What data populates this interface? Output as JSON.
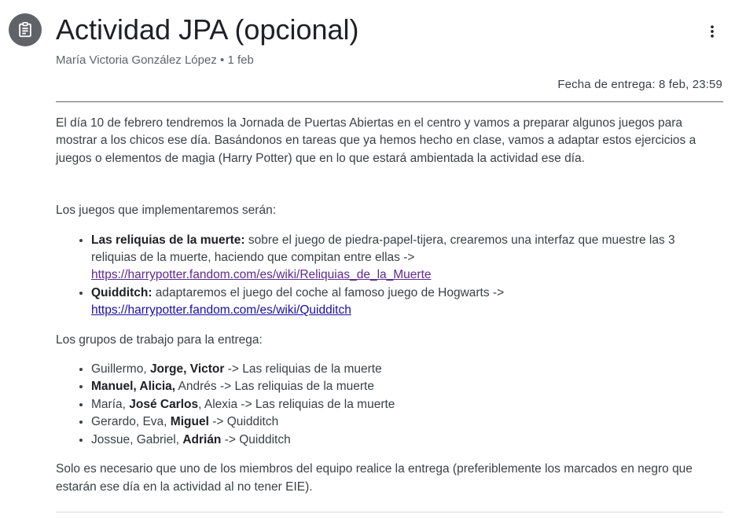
{
  "header": {
    "title": "Actividad JPA (opcional)",
    "author": "María Victoria González López",
    "date": "1 feb",
    "due": "Fecha de entrega: 8 feb, 23:59"
  },
  "body": {
    "intro": "El día 10 de febrero tendremos la Jornada de Puertas Abiertas en el centro y vamos a preparar algunos juegos para mostrar a los chicos ese día. Basándonos en tareas que ya hemos hecho en clase, vamos a adaptar estos ejercicios a juegos o elementos de magia (Harry Potter) que en lo que estará ambientada la actividad ese día.",
    "games_heading": "Los juegos que implementaremos serán:",
    "games": [
      {
        "name": "Las reliquias de la muerte:",
        "text": " sobre el juego de piedra-papel-tijera, crearemos una interfaz que muestre las 3 reliquias de la muerte, haciendo que compitan entre ellas -> ",
        "link": "https://harrypotter.fandom.com/es/wiki/Reliquias_de_la_Muerte"
      },
      {
        "name": "Quidditch:",
        "text": " adaptaremos el juego del coche al famoso juego de Hogwarts -> ",
        "link": "https://harrypotter.fandom.com/es/wiki/Quidditch"
      }
    ],
    "groups_heading": "Los grupos de trabajo para la entrega:",
    "groups": [
      {
        "a": "Guillermo, ",
        "b": "Jorge, Victor",
        "c": " -> Las reliquias de la muerte"
      },
      {
        "a": "",
        "b": "Manuel, Alicia,",
        "c": " Andrés -> Las reliquias de la muerte"
      },
      {
        "a": "María, ",
        "b": "José Carlos",
        "c": ", Alexia -> Las reliquias de la muerte"
      },
      {
        "a": "Gerardo, Eva, ",
        "b": "Miguel",
        "c": " -> Quidditch"
      },
      {
        "a": "Jossue, Gabriel, ",
        "b": "Adrián",
        "c": " -> Quidditch"
      }
    ],
    "footer_note": "Solo es necesario que uno de los miembros del equipo realice la entrega (preferiblemente los marcados en negro que estarán ese día en la actividad al no tener EIE)."
  },
  "icons": {
    "assignment": "assignment-icon",
    "more": "more-vert-icon"
  },
  "colors": {
    "icon_bg": "#5f6368",
    "link": "#1a0dab",
    "link_visited": "#5c2b8f",
    "title": "#202124",
    "text": "#3c4043"
  }
}
